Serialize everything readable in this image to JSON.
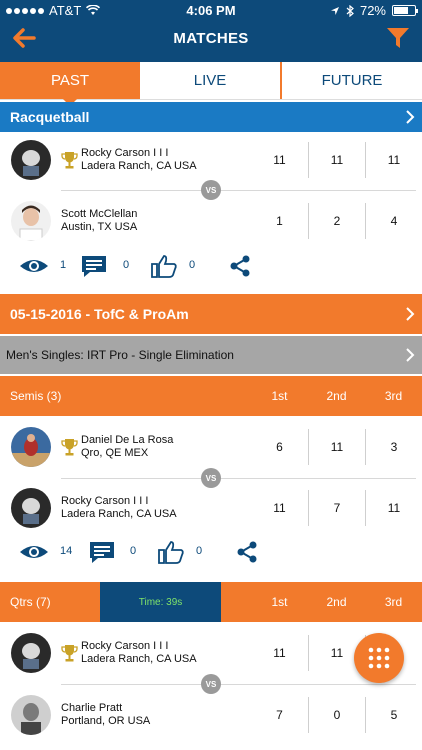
{
  "status_bar": {
    "carrier": "AT&T",
    "time": "4:06 PM",
    "battery": "72%",
    "battery_level": 0.72
  },
  "header": {
    "title": "MATCHES"
  },
  "tabs": [
    {
      "label": "PAST",
      "active": true
    },
    {
      "label": "LIVE",
      "active": false
    },
    {
      "label": "FUTURE",
      "active": false
    }
  ],
  "racquetball": {
    "title": "Racquetball",
    "match": {
      "player1": {
        "name": "Rocky Carson I I I",
        "location": "Ladera Ranch, CA USA",
        "scores": [
          "11",
          "11",
          "11"
        ],
        "winner": true
      },
      "player2": {
        "name": "Scott McClellan",
        "location": "Austin, TX USA",
        "scores": [
          "1",
          "2",
          "4"
        ],
        "winner": false
      },
      "vs": "VS",
      "stats": {
        "views": "1",
        "comments": "0",
        "likes": "0"
      }
    }
  },
  "event": {
    "title": "05-15-2016 - TofC & ProAm",
    "division": "Men's Singles: IRT Pro - Single Elimination",
    "games": [
      "1st",
      "2nd",
      "3rd"
    ],
    "semis": {
      "label": "Semis (3)",
      "player1": {
        "name": "Daniel De La Rosa",
        "location": "Qro, QE MEX",
        "scores": [
          "6",
          "11",
          "3"
        ],
        "winner": true
      },
      "player2": {
        "name": "Rocky Carson I I I",
        "location": "Ladera Ranch, CA USA",
        "scores": [
          "11",
          "7",
          "11"
        ],
        "winner": false
      },
      "vs": "VS",
      "stats": {
        "views": "14",
        "comments": "0",
        "likes": "0"
      }
    },
    "qtrs": {
      "label": "Qtrs (7)",
      "timer": "Time: 39s",
      "player1": {
        "name": "Rocky Carson I I I",
        "location": "Ladera Ranch, CA USA",
        "scores": [
          "11",
          "11",
          ""
        ],
        "winner": true
      },
      "player2": {
        "name": "Charlie Pratt",
        "location": "Portland, OR USA",
        "scores": [
          "7",
          "0",
          "5"
        ],
        "winner": false
      },
      "vs": "VS"
    }
  },
  "colors": {
    "navy": "#0d4a7a",
    "orange": "#f27a2c",
    "blue": "#1a7ac4",
    "gray": "#a6a6a6",
    "timer_text": "#7fe36a"
  }
}
